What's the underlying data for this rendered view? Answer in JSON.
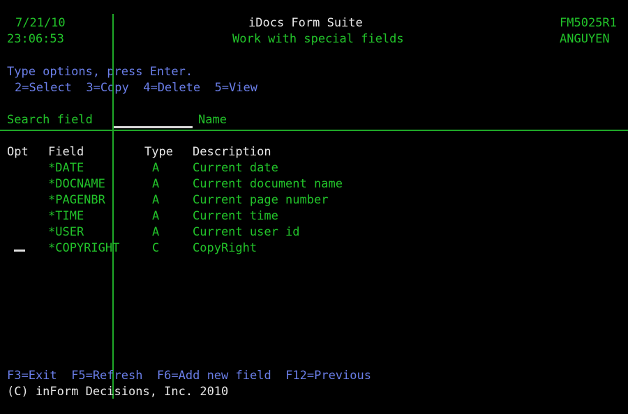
{
  "screen": {
    "background": "#000000",
    "green": "#22c32a",
    "white": "#e8e8e8",
    "blue": "#6a7ee8"
  },
  "header": {
    "date": "7/21/10",
    "time": "23:06:53",
    "app_title": "iDocs Form Suite",
    "screen_title": "Work with special fields",
    "program_id": "FM5025R1",
    "user_id": "ANGUYEN"
  },
  "instructions": {
    "prompt": "Type options, press Enter.",
    "options_line": "2=Select  3=Copy  4=Delete  5=View",
    "options": [
      {
        "code": "2",
        "label": "2=Select"
      },
      {
        "code": "3",
        "label": "3=Copy"
      },
      {
        "code": "4",
        "label": "4=Delete"
      },
      {
        "code": "5",
        "label": "5=View"
      }
    ]
  },
  "search": {
    "label": "Search field",
    "value": "",
    "placeholder": "",
    "name_label": "Name"
  },
  "list": {
    "columns": [
      "Opt",
      "Field",
      "Type",
      "Description"
    ],
    "rows": [
      {
        "opt": "",
        "field": "*DATE",
        "type": "A",
        "description": "Current date"
      },
      {
        "opt": "",
        "field": "*DOCNAME",
        "type": "A",
        "description": "Current document name"
      },
      {
        "opt": "",
        "field": "*PAGENBR",
        "type": "A",
        "description": "Current page number"
      },
      {
        "opt": "",
        "field": "*TIME",
        "type": "A",
        "description": "Current time"
      },
      {
        "opt": "",
        "field": "*USER",
        "type": "A",
        "description": "Current user id"
      },
      {
        "opt": "",
        "field": "*COPYRIGHT",
        "type": "C",
        "description": "CopyRight"
      }
    ]
  },
  "function_keys": {
    "line": "F3=Exit  F5=Refresh  F6=Add new field  F12=Previous",
    "keys": [
      {
        "key": "F3",
        "label": "F3=Exit"
      },
      {
        "key": "F5",
        "label": "F5=Refresh"
      },
      {
        "key": "F6",
        "label": "F6=Add new field"
      },
      {
        "key": "F12",
        "label": "F12=Previous"
      }
    ]
  },
  "footer": {
    "copyright": "(C) inForm Decisions, Inc. 2010"
  }
}
